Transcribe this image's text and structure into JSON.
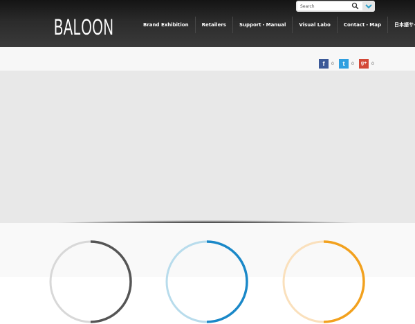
{
  "brand": {
    "logo": "BALOON"
  },
  "search": {
    "placeholder": "Search"
  },
  "nav": {
    "items": [
      "Brand Exhibition",
      "Retailers",
      "Support・Manual",
      "Visual Labo",
      "Contact・Map",
      "日本語サイト"
    ]
  },
  "social": [
    {
      "icon": "facebook-icon",
      "glyph": "f",
      "color": "#3b5998",
      "count": "0"
    },
    {
      "icon": "twitter-icon",
      "glyph": "t",
      "color": "#2f9fe0",
      "count": "0"
    },
    {
      "icon": "google-plus-icon",
      "glyph": "g+",
      "color": "#d34836",
      "count": "0"
    }
  ],
  "rings": [
    {
      "name": "progress-ring-dark",
      "base": "#d8d8d8",
      "accent": "#555555",
      "fraction": 0.5
    },
    {
      "name": "progress-ring-blue",
      "base": "#b8dcec",
      "accent": "#1a88c8",
      "fraction": 0.5
    },
    {
      "name": "progress-ring-orange",
      "base": "#fae0bc",
      "accent": "#f2a11e",
      "fraction": 0.5
    }
  ]
}
